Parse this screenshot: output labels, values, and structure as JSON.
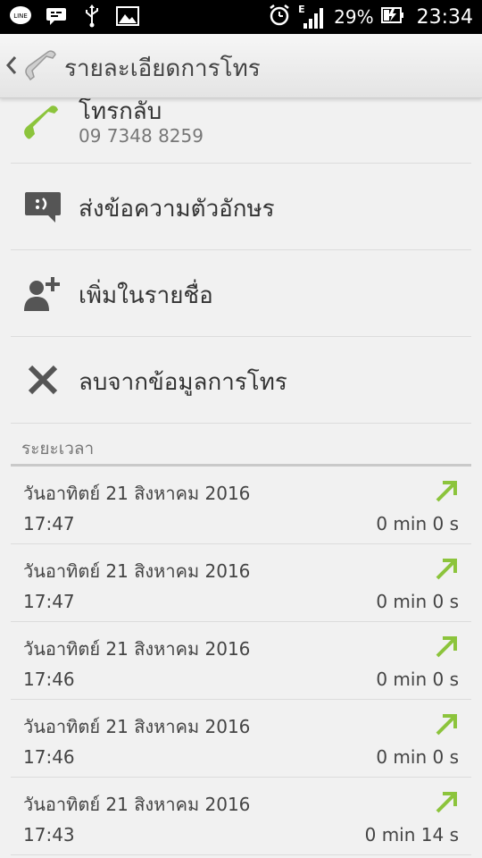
{
  "status_bar": {
    "icons_left": [
      "line-icon",
      "chat-icon",
      "usb-icon",
      "image-icon"
    ],
    "line_label": "LINE",
    "network_label": "E",
    "battery_percent": "29%",
    "time": "23:34"
  },
  "header": {
    "title": "รายละเอียดการโทร",
    "icon": "phone-icon"
  },
  "actions": {
    "call_back": {
      "label": "โทรกลับ",
      "number": "09 7348 8259",
      "icon": "phone-icon"
    },
    "send_sms": {
      "label": "ส่งข้อความตัวอักษร",
      "icon": "sms-icon"
    },
    "add_contact": {
      "label": "เพิ่มในรายชื่อ",
      "icon": "add-person-icon"
    },
    "delete_log": {
      "label": "ลบจากข้อมูลการโทร",
      "icon": "close-icon"
    }
  },
  "section": {
    "title": "ระยะเวลา"
  },
  "calls": [
    {
      "date": "วันอาทิตย์ 21 สิงหาคม 2016",
      "time": "17:47",
      "duration": "0 min 0 s",
      "icon": "outgoing-call-arrow-icon"
    },
    {
      "date": "วันอาทิตย์ 21 สิงหาคม 2016",
      "time": "17:47",
      "duration": "0 min 0 s",
      "icon": "outgoing-call-arrow-icon"
    },
    {
      "date": "วันอาทิตย์ 21 สิงหาคม 2016",
      "time": "17:46",
      "duration": "0 min 0 s",
      "icon": "outgoing-call-arrow-icon"
    },
    {
      "date": "วันอาทิตย์ 21 สิงหาคม 2016",
      "time": "17:46",
      "duration": "0 min 0 s",
      "icon": "outgoing-call-arrow-icon"
    },
    {
      "date": "วันอาทิตย์ 21 สิงหาคม 2016",
      "time": "17:43",
      "duration": "0 min 14 s",
      "icon": "outgoing-call-arrow-icon"
    }
  ],
  "colors": {
    "accent_green": "#8cc43c",
    "icon_gray": "#555555"
  }
}
